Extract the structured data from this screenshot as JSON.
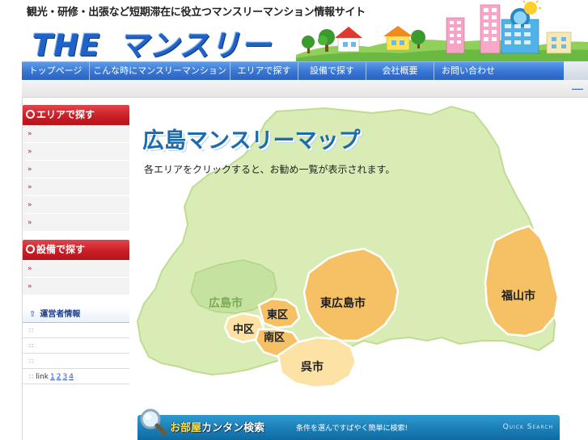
{
  "header": {
    "tagline": "観光・研修・出張など短期滞在に役立つマンスリーマンション情報サイト",
    "logo_part1": "THE",
    "logo_part2": "マンスリー"
  },
  "nav": {
    "items": [
      {
        "label": "トップページ"
      },
      {
        "label": "こんな時にマンスリーマンション"
      },
      {
        "label": "エリアで探す"
      },
      {
        "label": "設備で探す"
      },
      {
        "label": "会社概要"
      },
      {
        "label": "お問い合わせ"
      }
    ]
  },
  "sidebar": {
    "area_title": "エリアで探す",
    "area_link_count": 6,
    "facility_title": "設備で探す",
    "facility_link_count": 2,
    "admin_title": "運営者情報",
    "admin_link_count": 3,
    "link_label": "link",
    "link_pages": [
      "1",
      "2",
      "3",
      "4"
    ]
  },
  "main": {
    "map_title": "広島マンスリーマップ",
    "map_subtitle": "各エリアをクリックすると、お勧め一覧が表示されます。",
    "regions": {
      "hiroshima": "広島市",
      "naka": "中区",
      "higashi": "東区",
      "minami": "南区",
      "higashihiroshima": "東広島市",
      "kure": "呉市",
      "fukuyama": "福山市"
    },
    "colors": {
      "pref_fill": "#d9ecb5",
      "pref_stroke": "#bfdc92",
      "region_fill": "#f6c064",
      "region_light": "#fde2a6",
      "title_blue": "#1b6bb0"
    }
  },
  "quick_search": {
    "title_part1": "お部屋",
    "title_part2": "カンタン検索",
    "description": "条件を選んですばやく簡単に検索!",
    "english": "Quick Search"
  },
  "colors": {
    "nav_blue": "#3a78d6",
    "sidebar_red": "#c81c24",
    "logo_blue": "#1f63c9",
    "qs_blue": "#1b7fb7"
  }
}
